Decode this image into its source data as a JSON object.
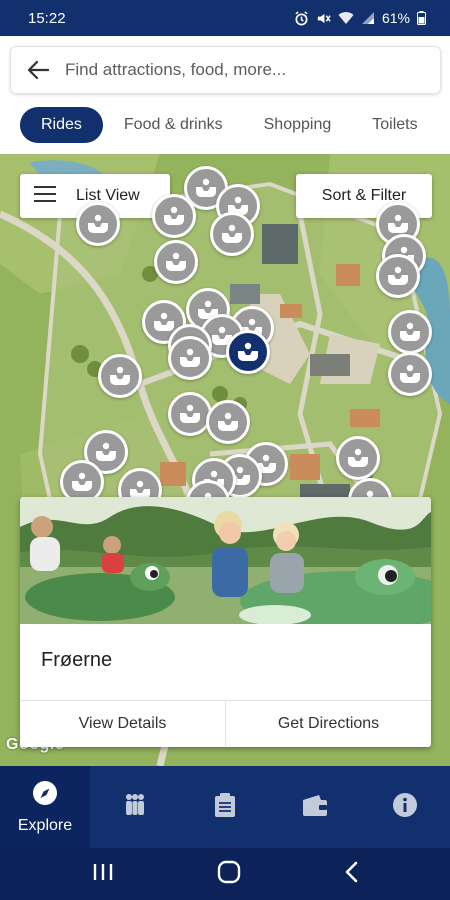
{
  "status_bar": {
    "time": "15:22",
    "battery": "61%",
    "icons": [
      "alarm-icon",
      "mute-icon",
      "wifi-icon",
      "signal-icon",
      "battery-icon"
    ]
  },
  "search": {
    "placeholder": "Find attractions, food, more..."
  },
  "tabs": [
    {
      "label": "Rides",
      "active": true
    },
    {
      "label": "Food & drinks",
      "active": false
    },
    {
      "label": "Shopping",
      "active": false
    },
    {
      "label": "Toilets",
      "active": false
    }
  ],
  "map": {
    "list_view_label": "List View",
    "sort_filter_label": "Sort & Filter",
    "attribution": "Google",
    "pin_icon": "ride-icon",
    "colors": {
      "grass": "#93b35c",
      "path": "#dcd8c8",
      "pin": "#9a9a9a",
      "selected_pin": "#12306e"
    }
  },
  "card": {
    "title": "Frøerne",
    "view_details_label": "View Details",
    "get_directions_label": "Get Directions"
  },
  "bottom_nav": [
    {
      "label": "Explore",
      "icon": "compass-icon",
      "active": true
    },
    {
      "label": "",
      "icon": "people-icon",
      "active": false
    },
    {
      "label": "",
      "icon": "clipboard-icon",
      "active": false
    },
    {
      "label": "",
      "icon": "wallet-icon",
      "active": false
    },
    {
      "label": "",
      "icon": "info-icon",
      "active": false
    }
  ],
  "theme": {
    "brand": "#12306e"
  }
}
